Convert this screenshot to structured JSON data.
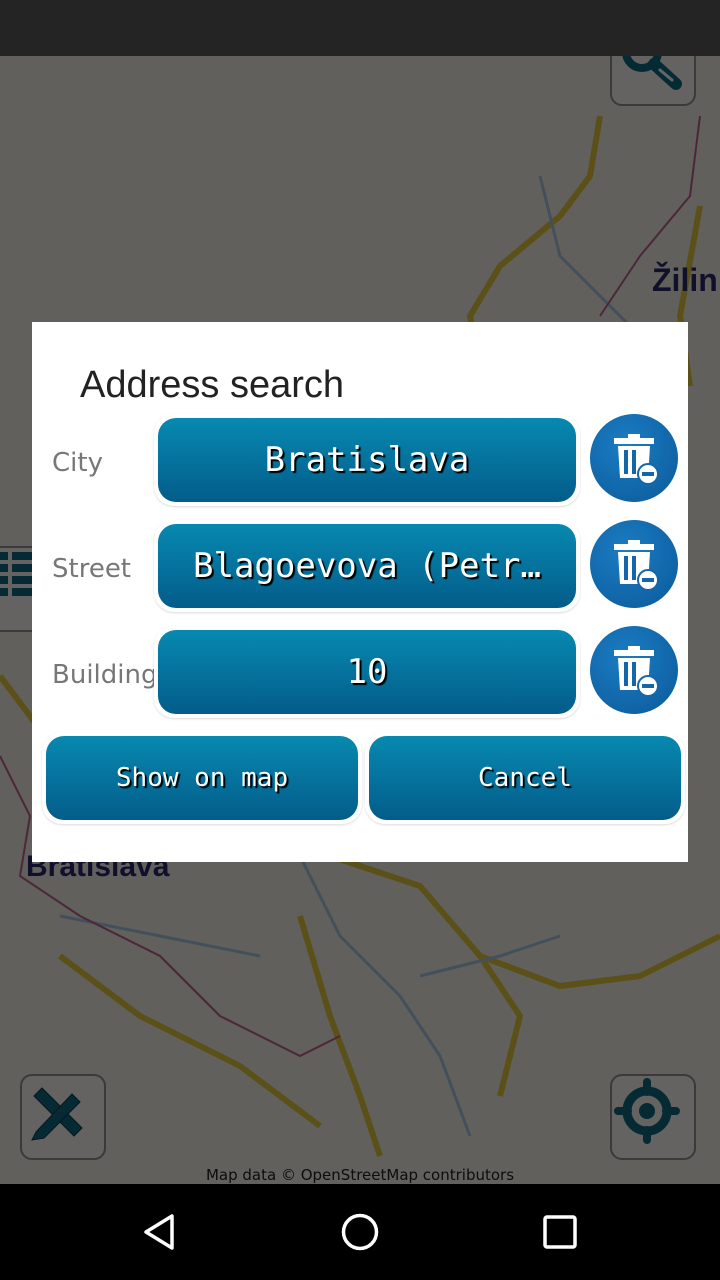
{
  "map": {
    "labels": [
      {
        "name": "label-zilina",
        "text": "Žilin"
      },
      {
        "name": "label-bratislava",
        "text": "Bratislava"
      }
    ],
    "attribution": "Map data © OpenStreetMap contributors",
    "colors": {
      "land": "#f2efe9",
      "road": "#e4c83a",
      "river": "#a8c8e6",
      "border": "#c06090"
    }
  },
  "buttons": {
    "search_icon": "magnifier-icon",
    "measure_icon": "ruler-pencil-icon",
    "locate_icon": "crosshair-icon"
  },
  "dialog": {
    "title": "Address search",
    "rows": [
      {
        "label": "City",
        "value": "Bratislava"
      },
      {
        "label": "Street",
        "value": "Blagoevova (Petr…"
      },
      {
        "label": "Building",
        "value": "10"
      }
    ],
    "show_on_map": "Show on map",
    "cancel": "Cancel",
    "accent": "#0680ab"
  },
  "nav": {
    "back": "back",
    "home": "home",
    "recents": "recents"
  }
}
